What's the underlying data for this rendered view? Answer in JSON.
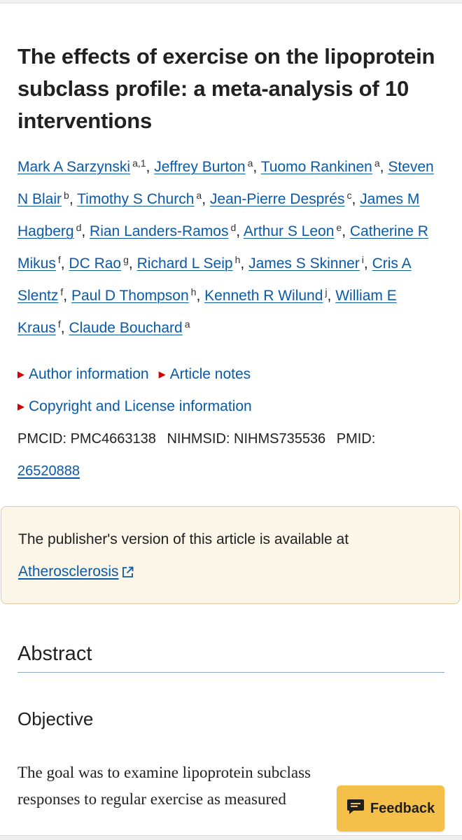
{
  "article": {
    "title": "The effects of exercise on the lipoprotein subclass profile: a meta-analysis of 10 interventions",
    "authors": [
      {
        "name": "Mark A Sarzynski",
        "sup": "a,1",
        "sep": ","
      },
      {
        "name": "Jeffrey Burton",
        "sup": "a",
        "sep": ","
      },
      {
        "name": "Tuomo Rankinen",
        "sup": "a",
        "sep": ","
      },
      {
        "name": "Steven N Blair",
        "sup": "b",
        "sep": ","
      },
      {
        "name": "Timothy S Church",
        "sup": "a",
        "sep": ","
      },
      {
        "name": "Jean-Pierre Després",
        "sup": "c",
        "sep": ","
      },
      {
        "name": "James M Hagberg",
        "sup": "d",
        "sep": ","
      },
      {
        "name": "Rian Landers-Ramos",
        "sup": "d",
        "sep": ","
      },
      {
        "name": "Arthur S Leon",
        "sup": "e",
        "sep": ","
      },
      {
        "name": "Catherine R Mikus",
        "sup": "f",
        "sep": ","
      },
      {
        "name": "DC Rao",
        "sup": "g",
        "sep": ","
      },
      {
        "name": "Richard L Seip",
        "sup": "h",
        "sep": ","
      },
      {
        "name": "James S Skinner",
        "sup": "i",
        "sep": ","
      },
      {
        "name": "Cris A Slentz",
        "sup": "f",
        "sep": ","
      },
      {
        "name": "Paul D Thompson",
        "sup": "h",
        "sep": ","
      },
      {
        "name": "Kenneth R Wilund",
        "sup": "j",
        "sep": ","
      },
      {
        "name": "William E Kraus",
        "sup": "f",
        "sep": ","
      },
      {
        "name": "Claude Bouchard",
        "sup": "a",
        "sep": ""
      }
    ],
    "links": {
      "author_info": "Author information",
      "article_notes": "Article notes",
      "copyright": "Copyright and License information"
    },
    "ids": {
      "pmcid_label": "PMCID:",
      "pmcid": "PMC4663138",
      "nihmsid_label": "NIHMSID:",
      "nihmsid": "NIHMS735536",
      "pmid_label": "PMID:",
      "pmid": "26520888"
    }
  },
  "notice": {
    "text": "The publisher's version of this article is available at",
    "link": "Atherosclerosis",
    "link_icon": "external-link-icon"
  },
  "abstract": {
    "heading": "Abstract",
    "subheading": "Objective",
    "line1": "The goal was to examine lipoprotein subclass",
    "line2": "responses to regular exercise as measured"
  },
  "feedback": {
    "label": "Feedback",
    "icon": "chat-bubble-icon"
  },
  "colors": {
    "link": "#0b5aa8",
    "triangle": "#d40000",
    "notice_bg": "#fcf6e9",
    "notice_border": "#e6c9a3",
    "feedback_bg": "#f5c04a"
  }
}
